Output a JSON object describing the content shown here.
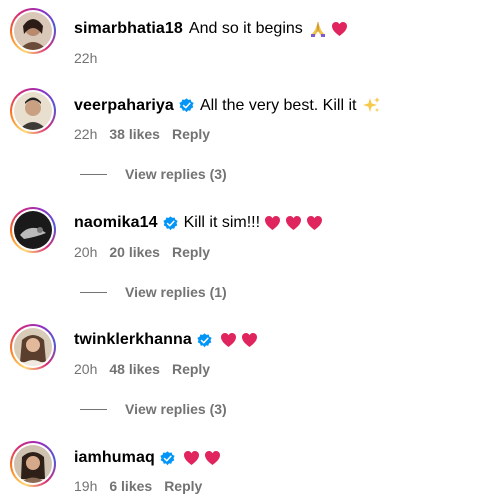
{
  "comments": [
    {
      "username": "simarbhatia18",
      "text": "And so it begins",
      "verified": false,
      "emojis": [
        "folded-hands",
        "red-heart"
      ],
      "time": "22h",
      "likes": "",
      "reply_label": ""
    },
    {
      "username": "veerpahariya",
      "text": "All the very best. Kill it",
      "verified": true,
      "emojis": [
        "sparkles"
      ],
      "time": "22h",
      "likes": "38 likes",
      "reply_label": "Reply",
      "view_replies": "View replies (3)"
    },
    {
      "username": "naomika14",
      "text": "Kill it sim!!!",
      "verified": true,
      "emojis": [
        "red-heart",
        "red-heart",
        "red-heart"
      ],
      "time": "20h",
      "likes": "20 likes",
      "reply_label": "Reply",
      "view_replies": "View replies (1)"
    },
    {
      "username": "twinklerkhanna",
      "text": "",
      "verified": true,
      "emojis": [
        "red-heart",
        "red-heart"
      ],
      "time": "20h",
      "likes": "48 likes",
      "reply_label": "Reply",
      "view_replies": "View replies (3)"
    },
    {
      "username": "iamhumaq",
      "text": "",
      "verified": true,
      "emojis": [
        "red-heart",
        "red-heart"
      ],
      "time": "19h",
      "likes": "6 likes",
      "reply_label": "Reply"
    }
  ],
  "colors": {
    "secondary_text": "#737373",
    "verified_blue": "#0095f6",
    "heart_red": "#e0245e"
  }
}
